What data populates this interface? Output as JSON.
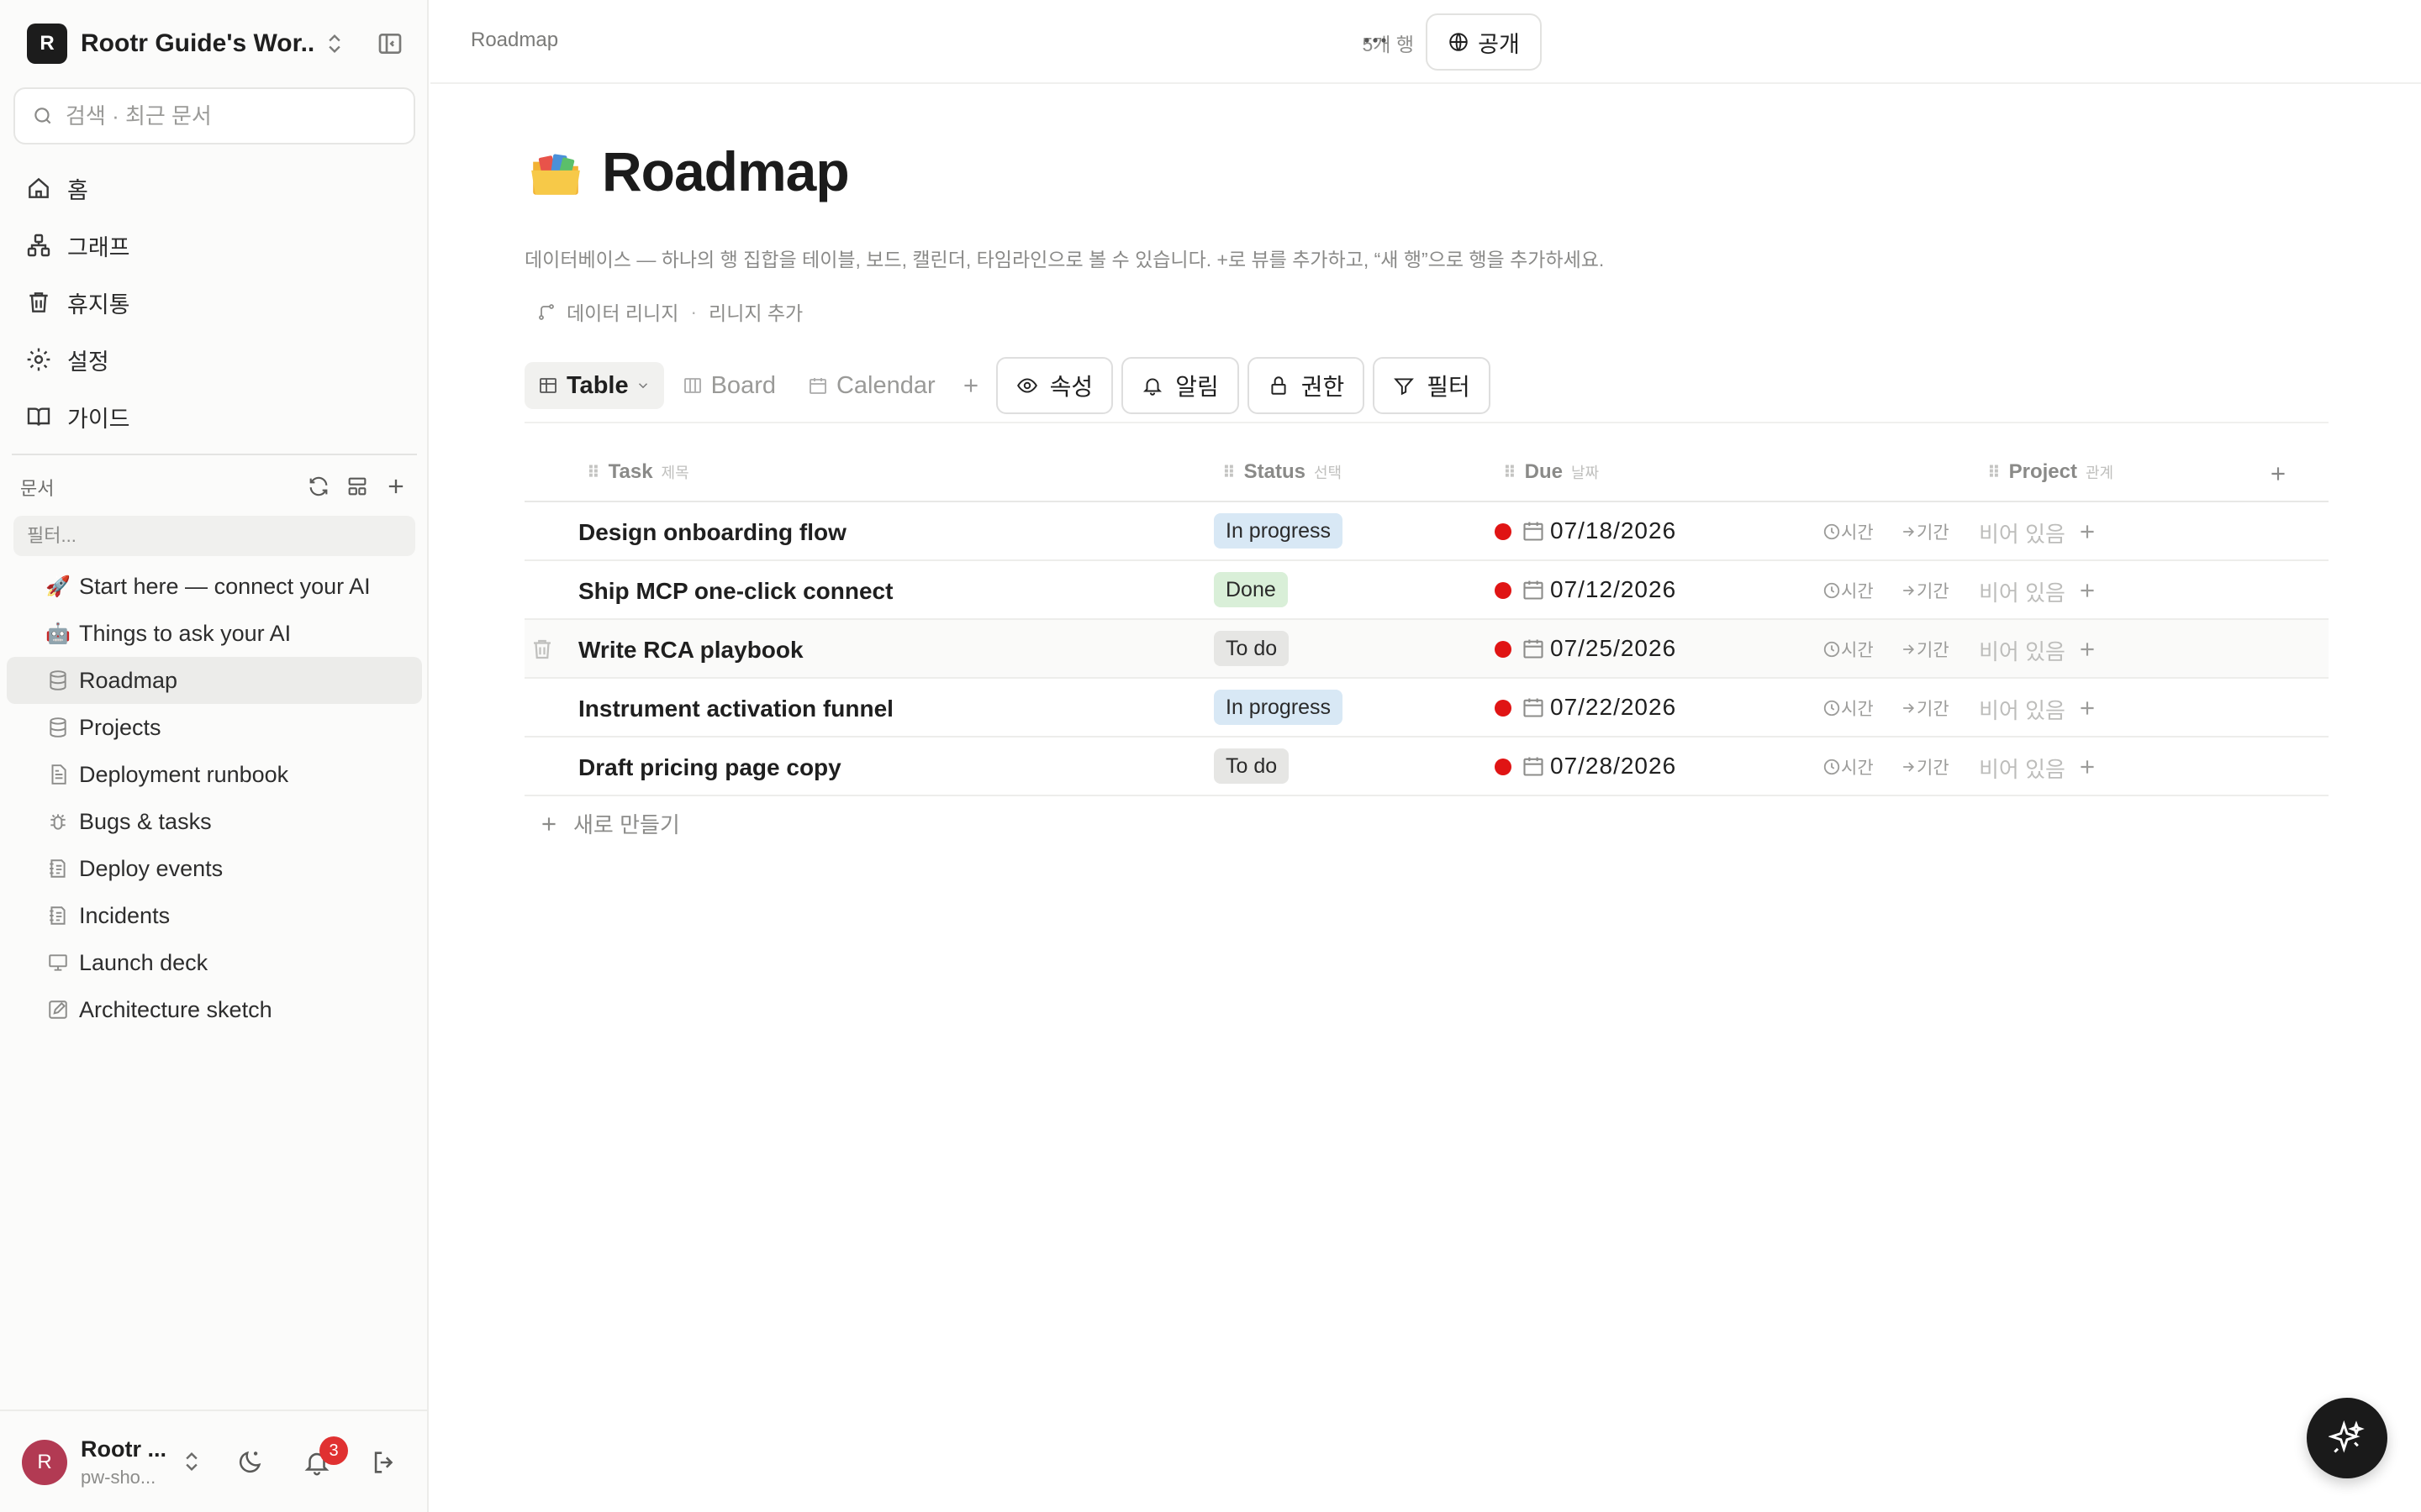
{
  "workspace": {
    "avatar_letter": "R",
    "name": "Rootr Guide's Wor..."
  },
  "search": {
    "placeholder": "검색 · 최근 문서"
  },
  "nav": [
    {
      "label": "홈",
      "icon": "home-icon"
    },
    {
      "label": "그래프",
      "icon": "graph-icon"
    },
    {
      "label": "휴지통",
      "icon": "trash-icon"
    },
    {
      "label": "설정",
      "icon": "gear-icon"
    },
    {
      "label": "가이드",
      "icon": "book-icon"
    }
  ],
  "docs_section": {
    "label": "문서",
    "filter_placeholder": "필터..."
  },
  "docs": [
    {
      "label": "Start here — connect your AI",
      "icon": "🚀",
      "active": false
    },
    {
      "label": "Things to ask your AI",
      "icon": "🤖",
      "active": false
    },
    {
      "label": "Roadmap",
      "icon": "database-icon",
      "active": true
    },
    {
      "label": "Projects",
      "icon": "database-icon",
      "active": false
    },
    {
      "label": "Deployment runbook",
      "icon": "page-icon",
      "active": false
    },
    {
      "label": "Bugs & tasks",
      "icon": "bug-icon",
      "active": false
    },
    {
      "label": "Deploy events",
      "icon": "log-icon",
      "active": false
    },
    {
      "label": "Incidents",
      "icon": "log-icon",
      "active": false
    },
    {
      "label": "Launch deck",
      "icon": "presentation-icon",
      "active": false
    },
    {
      "label": "Architecture sketch",
      "icon": "pencil-icon",
      "active": false
    }
  ],
  "user": {
    "avatar_letter": "R",
    "name": "Rootr ...",
    "email": "pw-sho...",
    "notifications": "3"
  },
  "topbar": {
    "breadcrumb": "Roadmap",
    "row_count": "5개 행",
    "public_label": "공개"
  },
  "page": {
    "icon": "folder-icon",
    "title": "Roadmap",
    "description": "데이터베이스 — 하나의 행 집합을 테이블, 보드, 캘린더, 타임라인으로 볼 수 있습니다. +로 뷰를 추가하고, “새 행”으로 행을 추가하세요.",
    "lineage_label": "데이터 리니지",
    "lineage_add": "리니지 추가"
  },
  "views": [
    {
      "label": "Table",
      "active": true
    },
    {
      "label": "Board",
      "active": false
    },
    {
      "label": "Calendar",
      "active": false
    }
  ],
  "toolbar": {
    "properties": "속성",
    "alerts": "알림",
    "permissions": "권한",
    "filter": "필터"
  },
  "columns": [
    {
      "label": "Task",
      "sub": "제목"
    },
    {
      "label": "Status",
      "sub": "선택"
    },
    {
      "label": "Due",
      "sub": "날짜"
    },
    {
      "label": "Project",
      "sub": "관계"
    }
  ],
  "rows": [
    {
      "task": "Design onboarding flow",
      "status": "In progress",
      "status_kind": "progress",
      "due": "07/18/2026",
      "time_label": "시간",
      "range_label": "기간",
      "project": "비어 있음"
    },
    {
      "task": "Ship MCP one-click connect",
      "status": "Done",
      "status_kind": "done",
      "due": "07/12/2026",
      "time_label": "시간",
      "range_label": "기간",
      "project": "비어 있음"
    },
    {
      "task": "Write RCA playbook",
      "status": "To do",
      "status_kind": "todo",
      "due": "07/25/2026",
      "time_label": "시간",
      "range_label": "기간",
      "project": "비어 있음"
    },
    {
      "task": "Instrument activation funnel",
      "status": "In progress",
      "status_kind": "progress",
      "due": "07/22/2026",
      "time_label": "시간",
      "range_label": "기간",
      "project": "비어 있음"
    },
    {
      "task": "Draft pricing page copy",
      "status": "To do",
      "status_kind": "todo",
      "due": "07/28/2026",
      "time_label": "시간",
      "range_label": "기간",
      "project": "비어 있음"
    }
  ],
  "new_row_label": "새로 만들기",
  "colors": {
    "status_progress": "#d8e8f5",
    "status_done": "#d9efd8",
    "status_todo": "#e6e6e4",
    "due_dot": "#e01414",
    "avatar": "#b23a53"
  }
}
